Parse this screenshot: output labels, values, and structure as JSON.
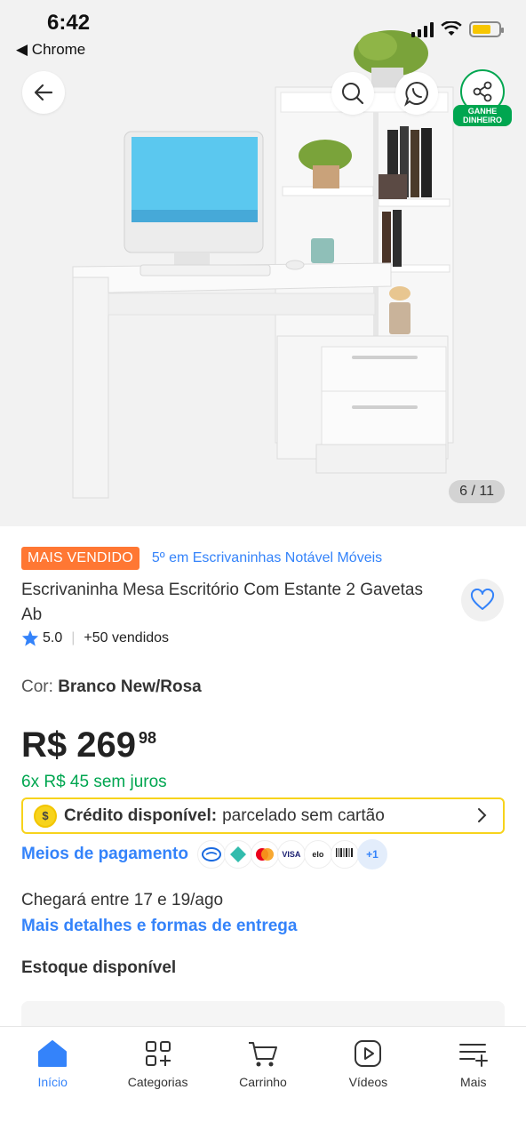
{
  "status_bar": {
    "time": "6:42",
    "back_app": "◀ Chrome",
    "battery_level": 0.7
  },
  "gallery": {
    "counter": "6 / 11",
    "share_badge": "GANHE DINHEIRO"
  },
  "product": {
    "badge": "MAIS VENDIDO",
    "ranking": "5º em Escrivaninhas Notável Móveis",
    "title": "Escrivaninha Mesa Escritório Com Estante 2 Gavetas Ab",
    "rating": "5.0",
    "sold": "+50 vendidos",
    "color_label": "Cor:",
    "color_value": "Branco New/Rosa",
    "price": "R$ 269",
    "price_cents": "98",
    "installments": "6x R$ 45 sem juros",
    "credit_title": "Crédito disponível:",
    "credit_text": "parcelado sem cartão",
    "payment_link": "Meios de pagamento",
    "payment_more": "+1",
    "delivery": "Chegará entre 17 e 19/ago",
    "delivery_link": "Mais detalhes e formas de entrega",
    "stock": "Estoque disponível"
  },
  "nav": [
    {
      "label": "Início",
      "icon": "home-icon",
      "active": true
    },
    {
      "label": "Categorias",
      "icon": "categories-icon"
    },
    {
      "label": "Carrinho",
      "icon": "cart-icon"
    },
    {
      "label": "Vídeos",
      "icon": "video-icon"
    },
    {
      "label": "Mais",
      "icon": "menu-more-icon"
    }
  ],
  "colors": {
    "accent": "#3483fa",
    "green": "#00a650",
    "orange": "#ff7733",
    "yellow": "#f7d31c"
  }
}
